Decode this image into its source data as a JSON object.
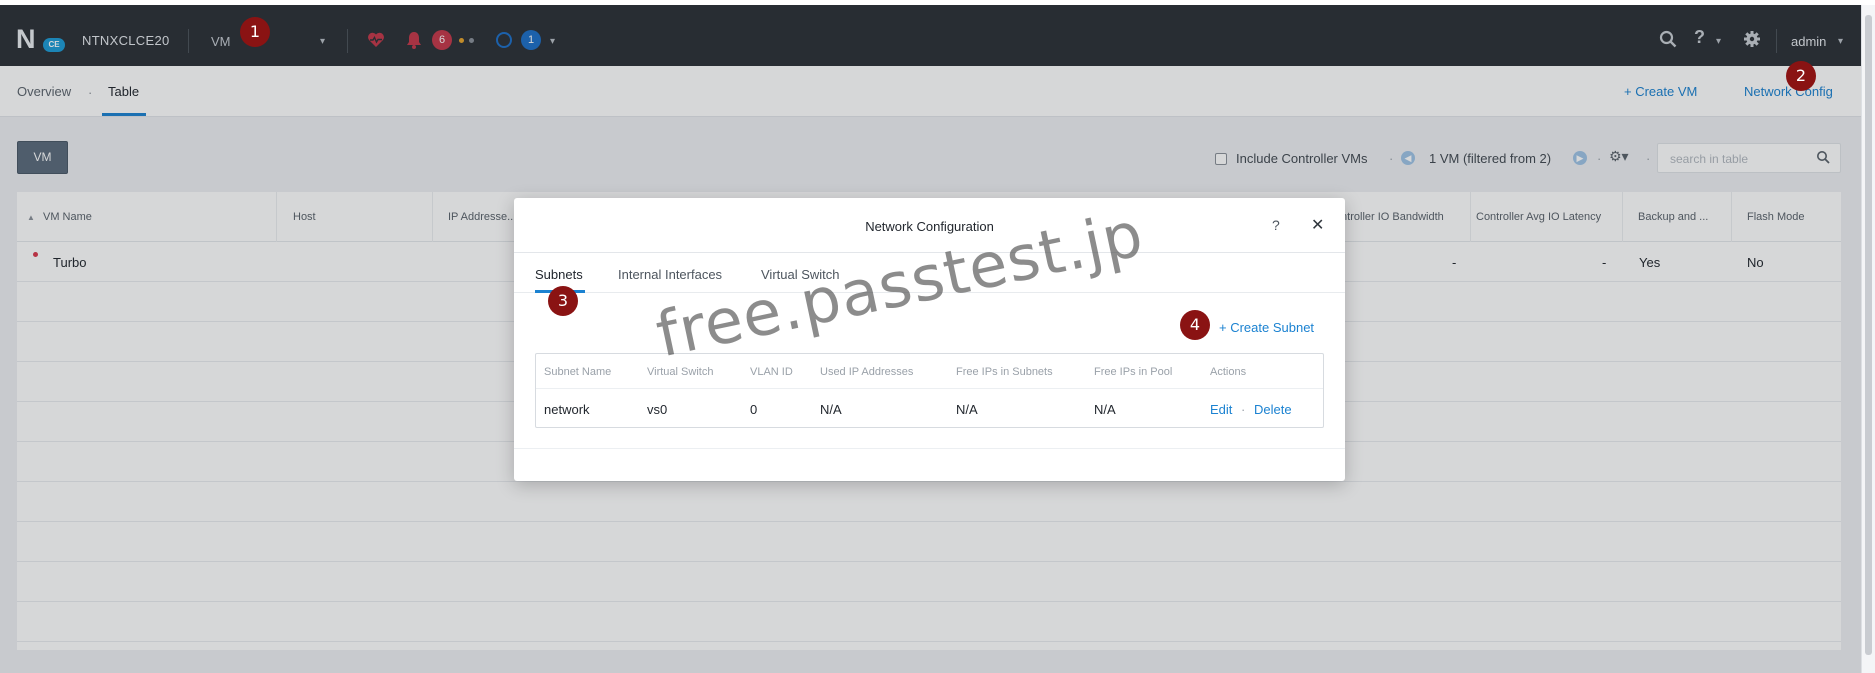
{
  "topbar": {
    "cluster_name": "NTNXCLCE20",
    "entity_selector": "VM",
    "logo_badge": "CE",
    "alerts_count": "6",
    "tasks_count": "1",
    "user": "admin",
    "icons": [
      "health-heart-icon",
      "alerts-bell-icon",
      "tasks-ring-icon",
      "search-icon",
      "help-icon",
      "gear-icon"
    ],
    "colors": {
      "bar_bg": "#2b3036",
      "alert_badge": "#c5384a",
      "task_badge": "#1d6fc8"
    }
  },
  "subbar": {
    "tabs": [
      {
        "label": "Overview"
      },
      {
        "label": "Table"
      }
    ],
    "create_vm": "+ Create VM",
    "network_config": "Network Config"
  },
  "toolbar": {
    "vm_button": "VM",
    "include_cvms": "Include Controller VMs",
    "filter_summary": "1 VM (filtered from 2)",
    "search_placeholder": "search in table"
  },
  "vm_table": {
    "columns": [
      "VM Name",
      "Host",
      "IP Addresse...",
      "Controller IO Bandwidth",
      "Controller Avg IO Latency",
      "Backup and ...",
      "Flash Mode"
    ],
    "rows": [
      {
        "name": "Turbo",
        "io_bandwidth": "-",
        "io_latency": "-",
        "backup": "Yes",
        "flash_mode": "No"
      }
    ]
  },
  "modal": {
    "title": "Network Configuration",
    "help": "?",
    "close": "✕",
    "tabs": [
      "Subnets",
      "Internal Interfaces",
      "Virtual Switch"
    ],
    "create_subnet": "+ Create Subnet",
    "subnet_columns": [
      "Subnet Name",
      "Virtual Switch",
      "VLAN ID",
      "Used IP Addresses",
      "Free IPs in Subnets",
      "Free IPs in Pool",
      "Actions"
    ],
    "subnets": [
      {
        "name": "network",
        "virtual_switch": "vs0",
        "vlan_id": "0",
        "used_ips": "N/A",
        "free_ips_subnets": "N/A",
        "free_ips_pool": "N/A",
        "edit": "Edit",
        "delete": "Delete"
      }
    ]
  },
  "annotations": {
    "markers": [
      "1",
      "2",
      "3",
      "4"
    ],
    "watermark": "free.passtest.jp",
    "marker_color": "#8a1313"
  }
}
